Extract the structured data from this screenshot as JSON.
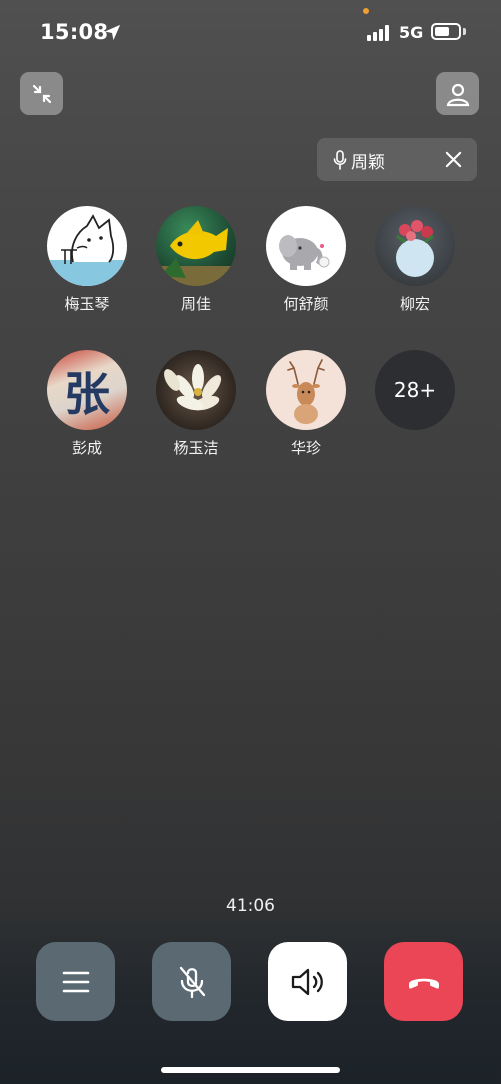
{
  "status_bar": {
    "time": "15:08",
    "network": "5G",
    "battery_level": 0.6
  },
  "active_speaker": {
    "name": "周颖",
    "mic_icon": "microphone-icon",
    "close_icon": "close-icon"
  },
  "participants": [
    {
      "name": "梅玉琴"
    },
    {
      "name": "周佳"
    },
    {
      "name": "何舒颜"
    },
    {
      "name": "柳宏"
    },
    {
      "name": "彭成",
      "avatar_text": "张"
    },
    {
      "name": "杨玉洁"
    },
    {
      "name": "华珍"
    }
  ],
  "more_participants": "28+",
  "call_duration": "41:06",
  "controls": {
    "menu_icon": "menu-icon",
    "mute_icon": "microphone-muted-icon",
    "speaker_icon": "speaker-icon",
    "hangup_icon": "hang-up-icon"
  },
  "colors": {
    "hangup": "#ea4656",
    "control_bg": "#5b6a72",
    "speaker_bg": "#ffffff"
  }
}
